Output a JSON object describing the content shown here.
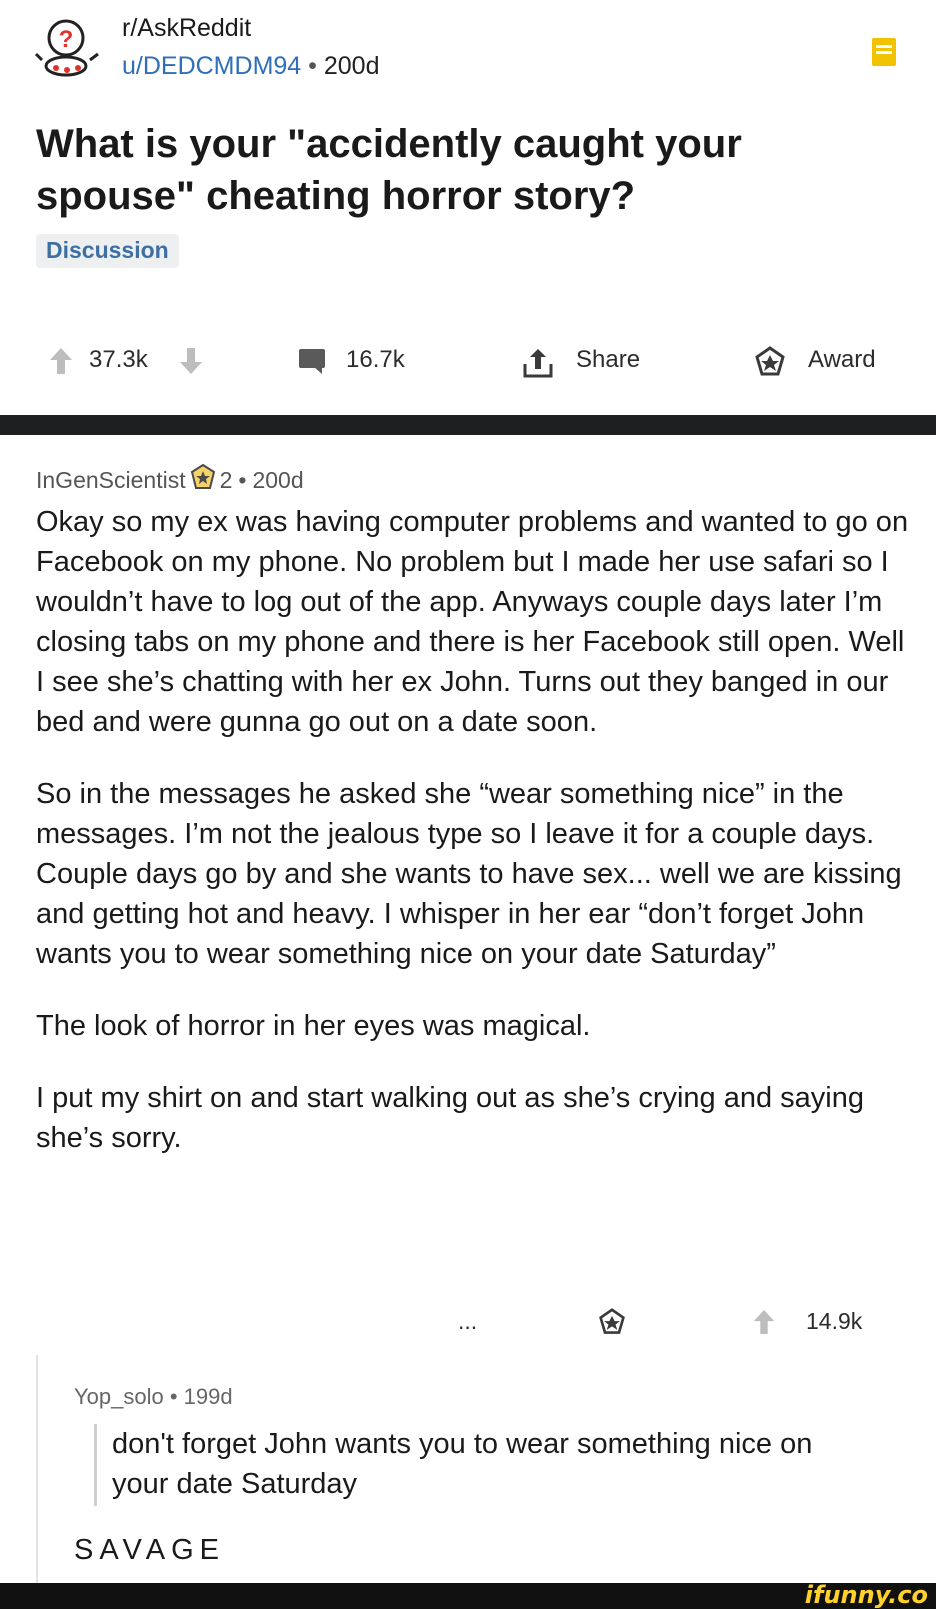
{
  "post": {
    "subreddit": "r/AskReddit",
    "author": "u/DEDCMDM94",
    "separator": "•",
    "age": "200d",
    "title": "What is your \"accidently caught your spouse\" cheating horror story?",
    "flair": "Discussion"
  },
  "actions": {
    "votes": "37.3k",
    "comments": "16.7k",
    "share_label": "Share",
    "award_label": "Award"
  },
  "comment": {
    "author": "InGenScientist",
    "badge_count": "2",
    "separator": "•",
    "age": "200d",
    "paragraphs": [
      "Okay so my ex was having computer problems and wanted to go on Facebook on my phone. No problem but I made her use safari so I wouldn’t have to log out of the app. Anyways couple days later I’m closing tabs on my phone and there is her Facebook still open. Well I see she’s chatting with her ex John. Turns out they banged in our bed and were gunna go out on a date soon.",
      "So in the messages he asked she “wear something nice” in the messages. I’m not the jealous type so I leave it for a couple days. Couple days go by and she wants to have sex... well we are kissing and getting hot and heavy. I whisper in her ear “don’t forget John wants you to wear something nice on your date Saturday”",
      "The look of horror in her eyes was magical.",
      "I put my shirt on and start walking out as she’s crying and saying she’s sorry."
    ],
    "more_label": "...",
    "votes": "14.9k"
  },
  "reply": {
    "author": "Yop_solo",
    "separator": "•",
    "age": "199d",
    "quote": "don't forget John wants you to wear something nice on your date Saturday",
    "text": "SAVAGE"
  },
  "watermark": "ifunny.co",
  "colors": {
    "link_blue": "#2f6fb8",
    "flair_bg": "#edeff1",
    "save_icon": "#f2c200",
    "divider": "#1e1f21",
    "watermark": "#ffd12a"
  },
  "icons": [
    "subreddit-avatar-icon",
    "save-icon",
    "upvote-icon",
    "downvote-icon",
    "comment-icon",
    "share-icon",
    "award-icon",
    "badge-icon",
    "more-icon"
  ]
}
